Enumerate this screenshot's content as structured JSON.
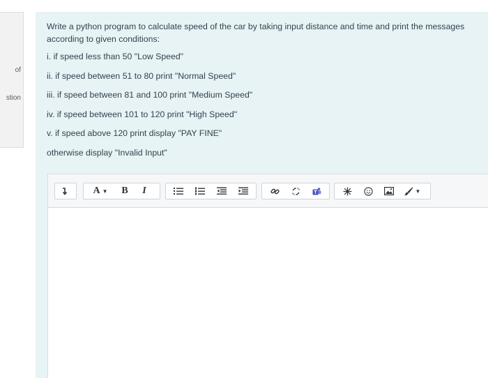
{
  "sidebar": {
    "line1": "of",
    "line2": "stion"
  },
  "question": {
    "intro": "Write a python program to calculate speed of the car by taking input distance and time and print the messages according to given conditions:",
    "conditions": [
      "i. if speed less than 50 \"Low Speed\"",
      "ii. if speed between 51 to 80 print \"Normal Speed\"",
      "iii. if speed between 81 and 100 print \"Medium Speed\"",
      "iv. if speed between 101 to 120 print \"High Speed\"",
      "v. if speed above 120 print display \"PAY FINE\"",
      "otherwise display \"Invalid Input\""
    ]
  },
  "toolbar": {
    "font_label": "A",
    "bold_label": "B",
    "italic_label": "I",
    "icons": [
      "toggle-toolbar-icon",
      "font-color-icon",
      "bold-icon",
      "italic-icon",
      "unordered-list-icon",
      "ordered-list-icon",
      "outdent-icon",
      "indent-icon",
      "link-icon",
      "unlink-icon",
      "teams-icon",
      "snowflake-icon",
      "emoji-icon",
      "image-icon",
      "brush-icon"
    ]
  },
  "colors": {
    "card_bg": "#e7f3f5",
    "text": "#334250",
    "toolbar_bg": "#f6f7f8"
  }
}
